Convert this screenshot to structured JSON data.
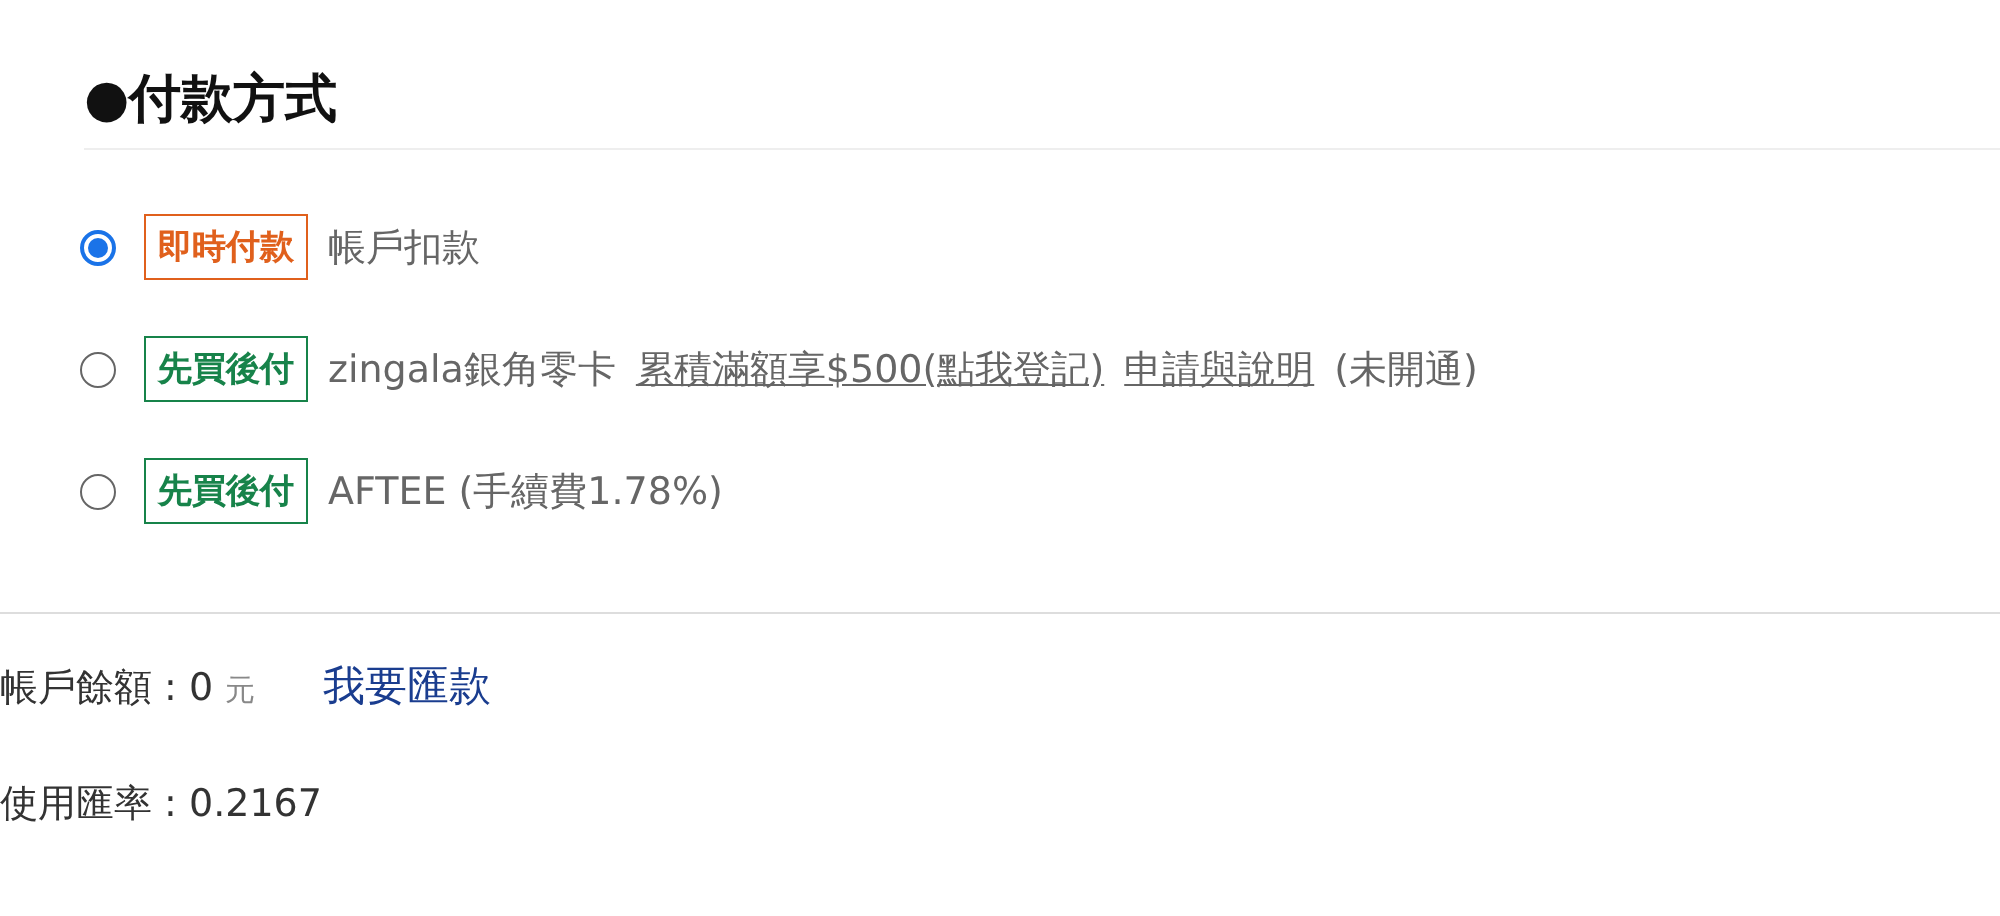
{
  "section_title": "●付款方式",
  "payment_options": [
    {
      "selected": true,
      "tag": {
        "label": "即時付款",
        "color": "#e0601c"
      },
      "parts": [
        {
          "kind": "text",
          "text": "帳戶扣款"
        }
      ]
    },
    {
      "selected": false,
      "tag": {
        "label": "先買後付",
        "color": "#17834a"
      },
      "parts": [
        {
          "kind": "text",
          "text": "zingala銀角零卡"
        },
        {
          "kind": "link",
          "text": "累積滿額享$500(點我登記)"
        },
        {
          "kind": "link",
          "text": "申請與說明"
        },
        {
          "kind": "text",
          "text": "(未開通)"
        }
      ]
    },
    {
      "selected": false,
      "tag": {
        "label": "先買後付",
        "color": "#17834a"
      },
      "parts": [
        {
          "kind": "text",
          "text": "AFTEE (手續費1.78%)"
        }
      ]
    }
  ],
  "balance": {
    "label": "帳戶餘額 : 0",
    "unit": "元",
    "action": "我要匯款"
  },
  "exchange_rate": "使用匯率 : 0.2167"
}
